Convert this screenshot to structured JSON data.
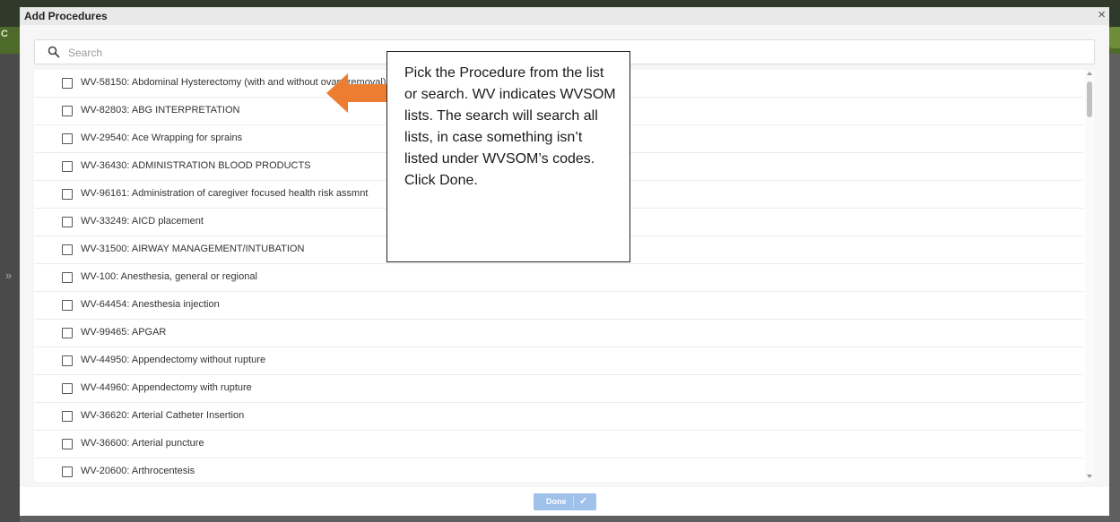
{
  "background": {
    "left_letter": "C",
    "collapse_icon": "double-chevron-right-icon"
  },
  "modal": {
    "title": "Add Procedures",
    "close_icon": "close-icon",
    "close_glyph": "×"
  },
  "search": {
    "icon": "search-icon",
    "placeholder": "Search",
    "value": ""
  },
  "procedures": [
    {
      "label": "WV-58150: Abdominal Hysterectomy (with and without ovary removal)",
      "checked": false
    },
    {
      "label": "WV-82803: ABG INTERPRETATION",
      "checked": false
    },
    {
      "label": "WV-29540: Ace Wrapping for sprains",
      "checked": false
    },
    {
      "label": "WV-36430: ADMINISTRATION BLOOD PRODUCTS",
      "checked": false
    },
    {
      "label": "WV-96161: Administration of caregiver focused health risk assmnt",
      "checked": false
    },
    {
      "label": "WV-33249: AICD placement",
      "checked": false
    },
    {
      "label": "WV-31500: AIRWAY MANAGEMENT/INTUBATION",
      "checked": false
    },
    {
      "label": "WV-100: Anesthesia, general or regional",
      "checked": false
    },
    {
      "label": "WV-64454: Anesthesia injection",
      "checked": false
    },
    {
      "label": "WV-99465: APGAR",
      "checked": false
    },
    {
      "label": "WV-44950: Appendectomy without rupture",
      "checked": false
    },
    {
      "label": "WV-44960: Appendectomy with rupture",
      "checked": false
    },
    {
      "label": "WV-36620: Arterial Catheter Insertion",
      "checked": false
    },
    {
      "label": "WV-36600: Arterial puncture",
      "checked": false
    },
    {
      "label": "WV-20600: Arthrocentesis",
      "checked": false
    }
  ],
  "footer": {
    "done_label": "Done",
    "done_icon": "checkmark-icon",
    "done_glyph": "✓",
    "done_enabled": false
  },
  "annotation": {
    "text": "Pick the Procedure from the list or search.  WV indicates WVSOM lists.  The search will search all lists, in case something isn’t listed under WVSOM’s codes.  Click Done.",
    "arrow_color": "#ED7D31"
  },
  "colors": {
    "done_button": "#9fc1ea",
    "header": "#e9e9e9",
    "app_green": "#4e6a2a"
  }
}
